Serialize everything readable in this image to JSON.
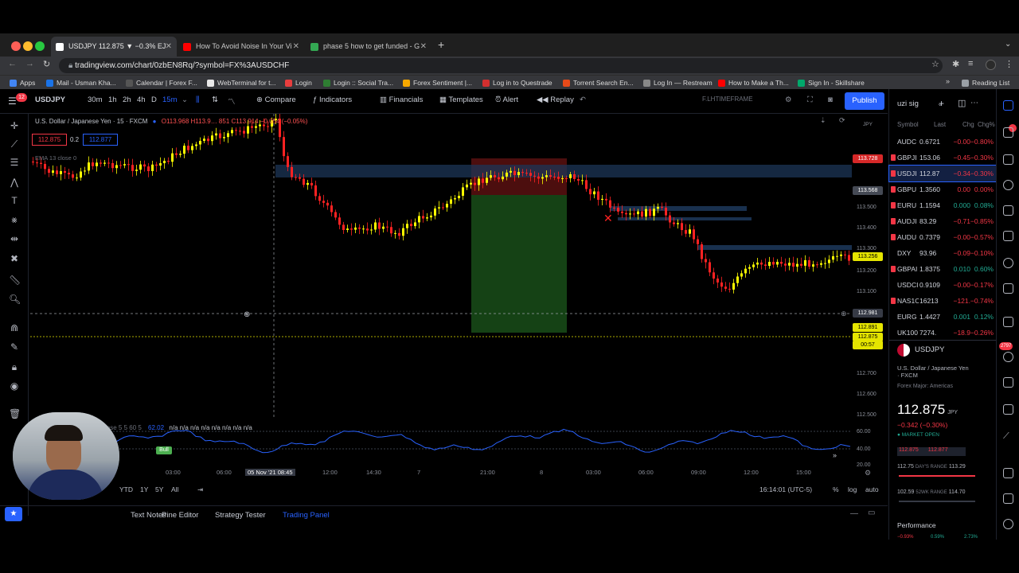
{
  "browser": {
    "tabs": [
      {
        "label": "USDJPY 112.875 ▼ −0.3% EJ",
        "active": true
      },
      {
        "label": "How To Avoid Noise In Your Vi"
      },
      {
        "label": "phase 5 how to get funded - G"
      }
    ],
    "url": "tradingview.com/chart/0zbEN8Rq/?symbol=FX%3AUSDCHF",
    "bookmarks": [
      "Apps",
      "Mail - Usman Kha...",
      "Calendar | Forex F...",
      "WebTerminal for t...",
      "Login",
      "Login :: Social Tra...",
      "Forex Sentiment |...",
      "Log in to Questrade",
      "Torrent Search En...",
      "Log In — Restream",
      "How to Make a Th...",
      "Sign In - Skillshare",
      "Reading List"
    ]
  },
  "toolbar": {
    "badge": "12",
    "symbol": "USDJPY",
    "intervals": [
      "30m",
      "1h",
      "2h",
      "4h",
      "D",
      "15m"
    ],
    "compare": "Compare",
    "indicators": "Indicators",
    "financials": "Financials",
    "templates": "Templates",
    "alert": "Alert",
    "replay": "Replay",
    "timeframe_label": "F.LHTIMEFRAME",
    "publish": "Publish"
  },
  "chart": {
    "title": "U.S. Dollar / Japanese Yen · 15 · FXCM",
    "ohlc": "O113.968 H113.9… 851 C113.914 −0.054 (−0.05%)",
    "bid": "112.875",
    "spread": "0.2",
    "ask": "112.877",
    "ema_label": "EMA 13 close 0",
    "osc_legend": "close 5 5 60 5",
    "osc_value": "62.02",
    "osc_na": "n/a n/a n/a n/a n/a n/a n/a n/a",
    "bull_label": "Bull",
    "currency": "JPY",
    "price_labels": [
      "113.728",
      "113.568",
      "113.500",
      "113.400",
      "113.300",
      "113.256",
      "113.200",
      "113.100",
      "112.981",
      "112.891",
      "112.875",
      "112.700",
      "112.600",
      "112.500",
      "60.00",
      "40.00",
      "20.00"
    ],
    "cursor_time": "00:57",
    "time_labels": [
      "03:00",
      "06:00",
      "05 Nov '21",
      "08:45",
      "12:00",
      "14:30",
      "7",
      "21:00",
      "8",
      "03:00",
      "06:00",
      "09:00",
      "12:00",
      "15:00"
    ],
    "ranges": [
      "YTD",
      "1Y",
      "5Y",
      "All"
    ],
    "clock": "16:14:01 (UTC-5)",
    "scale_opts": [
      "%",
      "log",
      "auto"
    ]
  },
  "panel_tabs": [
    "Text Notes",
    "Pine Editor",
    "Strategy Tester",
    "Trading Panel"
  ],
  "watchlist": {
    "title": "uzi sig",
    "headers": [
      "Symbol",
      "Last",
      "Chg",
      "Chg%"
    ],
    "rows": [
      {
        "s": "AUDC",
        "l": "0.6721",
        "c": "−0.00",
        "p": "−0.80%",
        "up": false,
        "mark": ""
      },
      {
        "s": "GBPJI",
        "l": "153.06",
        "c": "−0.45",
        "p": "−0.30%",
        "up": false,
        "mark": "#f23645"
      },
      {
        "s": "USDJI",
        "l": "112.87",
        "c": "−0.34",
        "p": "−0.30%",
        "up": false,
        "mark": "#f23645"
      },
      {
        "s": "GBPU",
        "l": "1.3560",
        "c": "0.00",
        "p": "0.00%",
        "up": false,
        "mark": "#f23645"
      },
      {
        "s": "EURU",
        "l": "1.1594",
        "c": "0.000",
        "p": "0.08%",
        "up": true,
        "mark": "#f23645"
      },
      {
        "s": "AUDJI",
        "l": "83.29",
        "c": "−0.71",
        "p": "−0.85%",
        "up": false,
        "mark": "#f23645"
      },
      {
        "s": "AUDU",
        "l": "0.7379",
        "c": "−0.00",
        "p": "−0.57%",
        "up": false,
        "mark": "#f23645"
      },
      {
        "s": "DXY",
        "l": "93.96",
        "c": "−0.09",
        "p": "−0.10%",
        "up": false,
        "mark": ""
      },
      {
        "s": "GBPAI",
        "l": "1.8375",
        "c": "0.010",
        "p": "0.60%",
        "up": true,
        "mark": "#f23645"
      },
      {
        "s": "USDCI",
        "l": "0.9109",
        "c": "−0.00",
        "p": "−0.17%",
        "up": false,
        "mark": ""
      },
      {
        "s": "NAS1C",
        "l": "16213",
        "c": "−121.",
        "p": "−0.74%",
        "up": false,
        "mark": "#f23645"
      },
      {
        "s": "EURG",
        "l": "1.4427",
        "c": "0.001",
        "p": "0.12%",
        "up": true,
        "mark": ""
      },
      {
        "s": "UK100",
        "l": "7274.",
        "c": "−18.9",
        "p": "−0.26%",
        "up": false,
        "mark": ""
      }
    ],
    "detail_symbol": "USDJPY",
    "detail_name": "U.S. Dollar / Japanese Yen",
    "detail_exchange": "· FXCM",
    "detail_category": "Forex Major: Americas",
    "detail_price": "112.875",
    "detail_price_unit": "JPY",
    "detail_change": "−0.342 (−0.30%)",
    "detail_status": "● MARKET OPEN",
    "detail_bid": "112.875",
    "detail_ask": "112.877",
    "days_range_low": "112.75",
    "days_range_label": "DAY'S RANGE",
    "days_range_high": "113.29",
    "wk_range_low": "102.59",
    "wk_range_label": "52WK RANGE",
    "wk_range_high": "114.70",
    "performance": "Performance",
    "perf_values": [
      "−0.93%",
      "0.59%",
      "2.73%"
    ],
    "notif_badge": "2797"
  },
  "colors": {
    "up_candle": "#ffff00",
    "down_candle": "#ff2222",
    "osc": "#2962ff",
    "accent": "#2962ff",
    "neg": "#f23645",
    "pos": "#22ab94"
  }
}
